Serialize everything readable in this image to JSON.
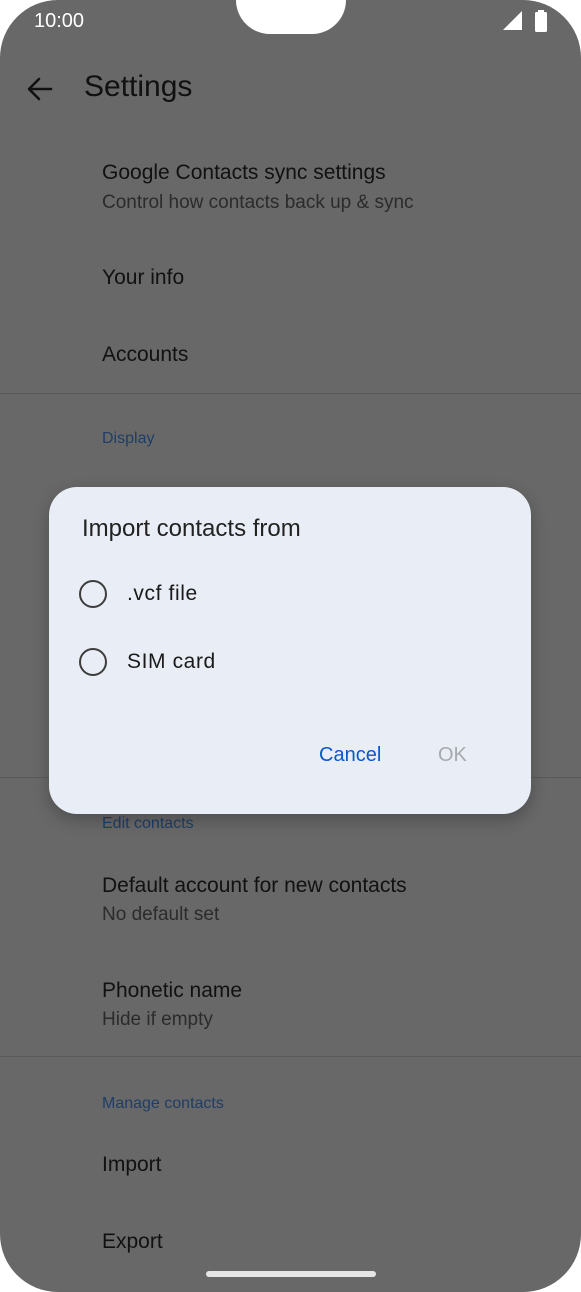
{
  "status_bar": {
    "time": "10:00"
  },
  "header": {
    "title": "Settings"
  },
  "settings": {
    "google_sync": {
      "title": "Google Contacts sync settings",
      "subtitle": "Control how contacts back up & sync"
    },
    "your_info": {
      "title": "Your info"
    },
    "accounts": {
      "title": "Accounts"
    },
    "display_header": "Display",
    "edit_contacts_header": "Edit contacts",
    "default_account": {
      "title": "Default account for new contacts",
      "subtitle": "No default set"
    },
    "phonetic_name": {
      "title": "Phonetic name",
      "subtitle": "Hide if empty"
    },
    "manage_contacts_header": "Manage contacts",
    "import": {
      "title": "Import"
    },
    "export": {
      "title": "Export"
    }
  },
  "dialog": {
    "title": "Import contacts from",
    "options": [
      ".vcf file",
      "SIM card"
    ],
    "cancel_label": "Cancel",
    "ok_label": "OK"
  }
}
